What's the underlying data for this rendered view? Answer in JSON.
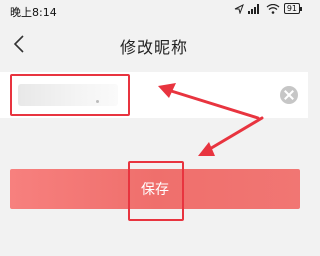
{
  "status_bar": {
    "time": "晚上8:14",
    "battery": "91"
  },
  "header": {
    "title": "修改昵称"
  },
  "name_input": {
    "value": "",
    "placeholder": ""
  },
  "save_button": {
    "label": "保存"
  },
  "colors": {
    "accent": "#ef6f6c",
    "annotation": "#e8343f",
    "background": "#f2f2f2"
  }
}
